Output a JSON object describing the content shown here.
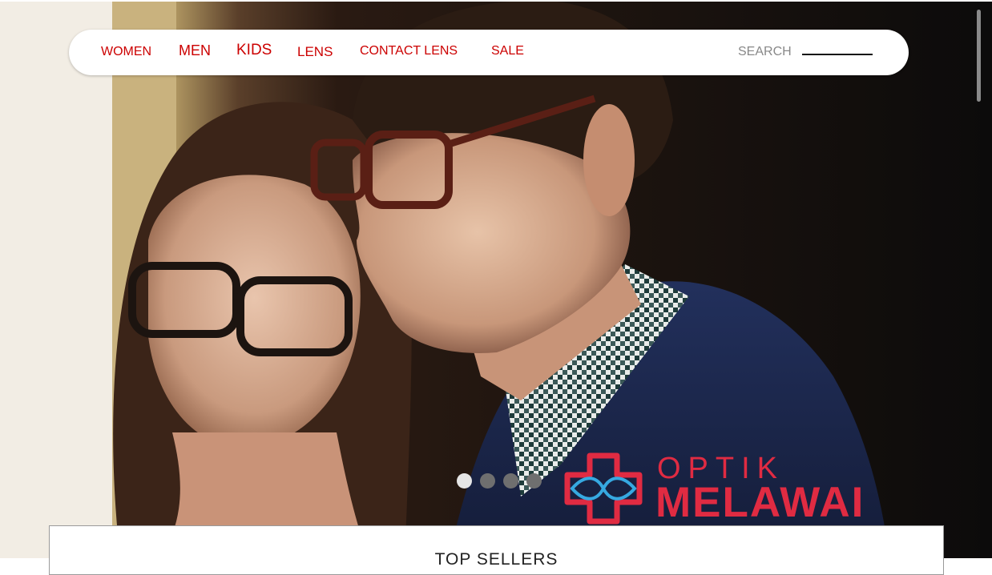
{
  "nav": {
    "items": [
      {
        "label": "WOMEN"
      },
      {
        "label": "MEN"
      },
      {
        "label": "KIDS"
      },
      {
        "label": "LENS"
      },
      {
        "label": "CONTACT LENS"
      },
      {
        "label": "SALE"
      }
    ],
    "search_label": "SEARCH",
    "search_value": ""
  },
  "hero": {
    "slide_count": 4,
    "active_slide": 1
  },
  "brand": {
    "line1": "OPTIK",
    "line2": "MELAWAI",
    "color": "#e02b42",
    "mark_accent": "#36a9e1"
  },
  "section": {
    "title": "TOP SELLERS"
  },
  "colors": {
    "nav_text": "#cc0000",
    "nav_bg": "#ffffff"
  }
}
